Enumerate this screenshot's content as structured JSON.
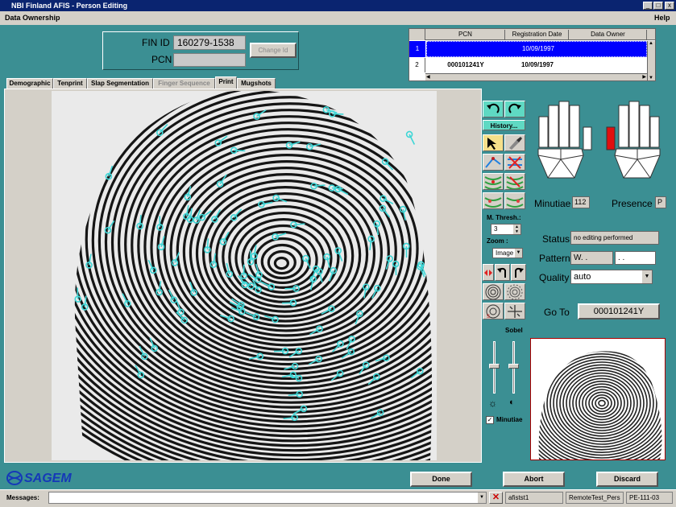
{
  "window": {
    "title": "NBI Finland AFIS - Person Editing",
    "min_glyph": "_",
    "max_glyph": "□",
    "close_glyph": "x"
  },
  "menu": {
    "left": "Data Ownership",
    "right": "Help"
  },
  "id_panel": {
    "fin_id_label": "FIN ID",
    "fin_id_value": "160279-1538",
    "pcn_label": "PCN",
    "pcn_value": "",
    "change_id_label": "Change Id"
  },
  "grid": {
    "headers": [
      "PCN",
      "Registration Date",
      "Data Owner"
    ],
    "rows": [
      {
        "num": "1",
        "pcn": "",
        "date": "10/09/1997",
        "owner": ""
      },
      {
        "num": "2",
        "pcn": "000101241Y",
        "date": "10/09/1997",
        "owner": ""
      }
    ]
  },
  "tabs": [
    "Demographic",
    "Tenprint",
    "Slap Segmentation",
    "Finger Sequence",
    "Print",
    "Mugshots"
  ],
  "active_tab": "Print",
  "tools": {
    "history": "History...",
    "mthresh_label": "M. Thresh.:",
    "mthresh_value": "3",
    "zoom_label": "Zoom :",
    "zoom_value": "Image",
    "sobel": "Sobel",
    "minutiae_check": "Minutiae"
  },
  "info": {
    "minutiae_label": "Minutiae",
    "minutiae_value": "112",
    "presence_label": "Presence",
    "presence_value": "P",
    "status_label": "Status",
    "status_value": "no editing performed",
    "pattern_label": "Pattern",
    "pattern_value1": "W. .",
    "pattern_value2": ". .",
    "quality_label": "Quality",
    "quality_value": "auto",
    "goto_label": "Go To",
    "goto_value": "000101241Y"
  },
  "footer": {
    "logo": "SAGEM",
    "done": "Done",
    "abort": "Abort",
    "discard": "Discard"
  },
  "status": {
    "messages_label": "Messages:",
    "cell1": "afistst1",
    "cell2": "RemoteTest_Pers",
    "cell3": "PE-111-03"
  },
  "colors": {
    "teal": "#3b8f93",
    "minutiae": "#3ed6d6",
    "selected_row": "#0000ff",
    "finger_highlight": "#e01010"
  }
}
